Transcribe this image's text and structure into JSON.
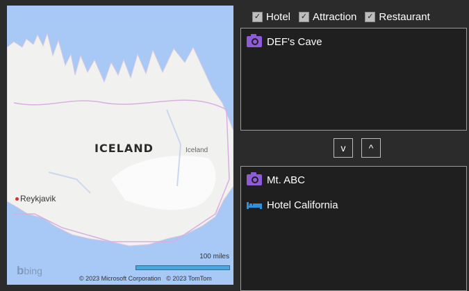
{
  "map": {
    "country_label": "ICELAND",
    "region_label": "Iceland",
    "city_label": "Reykjavik",
    "scale_label": "100 miles",
    "provider_logo": "bing",
    "copyright_ms": "© 2023 Microsoft Corporation",
    "copyright_tomtom": "© 2023 TomTom"
  },
  "filters": [
    {
      "label": "Hotel",
      "checked": true
    },
    {
      "label": "Attraction",
      "checked": true
    },
    {
      "label": "Restaurant",
      "checked": true
    }
  ],
  "top_list": {
    "items": [
      {
        "label": "DEF's Cave",
        "icon": "camera-icon",
        "icon_color": "#8e5bd9"
      }
    ]
  },
  "buttons": {
    "down_label": "v",
    "up_label": "^"
  },
  "bottom_list": {
    "items": [
      {
        "label": "Mt. ABC",
        "icon": "camera-icon",
        "icon_color": "#8e5bd9"
      },
      {
        "label": "Hotel California",
        "icon": "bed-icon",
        "icon_color": "#2f8fd9"
      }
    ]
  }
}
